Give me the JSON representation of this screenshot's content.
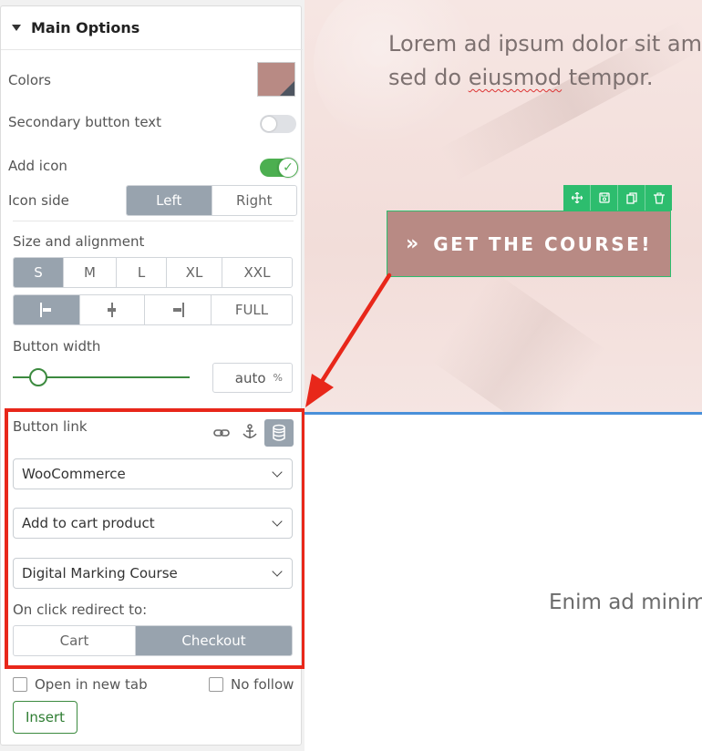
{
  "panel": {
    "title": "Main Options",
    "colors_label": "Colors",
    "secondary_text_label": "Secondary button text",
    "add_icon_label": "Add icon",
    "icon_side_label": "Icon side",
    "icon_side_options": [
      "Left",
      "Right"
    ],
    "icon_side_selected": "Left",
    "size_label": "Size and alignment",
    "sizes": [
      "S",
      "M",
      "L",
      "XL",
      "XXL"
    ],
    "size_selected": "S",
    "alignment_full_label": "FULL",
    "button_width_label": "Button width",
    "button_width_value": "auto",
    "button_width_unit": "%",
    "button_link_label": "Button link",
    "link_source": "WooCommerce",
    "link_action": "Add to cart product",
    "link_product": "Digital Marking Course",
    "redirect_label": "On click redirect to:",
    "redirect_options": [
      "Cart",
      "Checkout"
    ],
    "redirect_selected": "Checkout",
    "open_new_tab_label": "Open in new tab",
    "no_follow_label": "No follow",
    "insert_label": "Insert",
    "secondary_text_enabled": false,
    "add_icon_enabled": true
  },
  "canvas": {
    "hero_line1": "Lorem ad ipsum dolor sit ame",
    "hero_line2_a": "sed do ",
    "hero_line2_b": "eiusmod",
    "hero_line2_c": " tempor.",
    "button_label": "GET THE COURSE!",
    "button_icon": "»",
    "lower_text": "Enim ad minim"
  },
  "icons": {
    "toolbar": [
      "move-icon",
      "save-icon",
      "duplicate-icon",
      "delete-icon"
    ],
    "link_types": [
      "link-icon",
      "anchor-icon",
      "database-icon"
    ]
  },
  "colors": {
    "button_bg": "#b88a84",
    "accent_green": "#2dbd6e",
    "highlight_red": "#e8271a",
    "active_gray": "#98a3ae"
  }
}
